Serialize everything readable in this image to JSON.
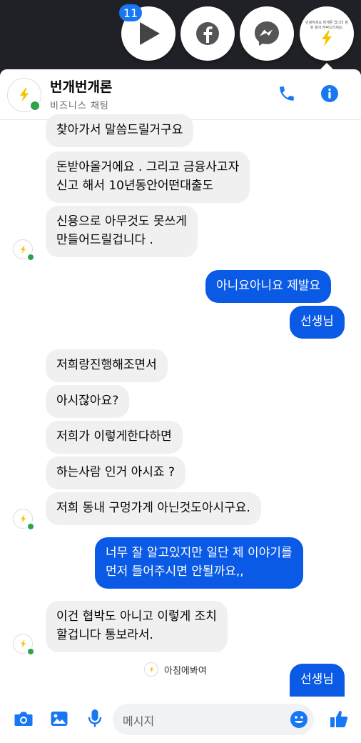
{
  "chat_heads": {
    "badge_count": "11",
    "items": [
      {
        "name": "play-head"
      },
      {
        "name": "facebook-head"
      },
      {
        "name": "messenger-head"
      },
      {
        "name": "business-head"
      }
    ],
    "business_avatar_text": "안녕하세요 번개론 입니다 참된 분의 부탁드리세요."
  },
  "header": {
    "title": "번개번개론",
    "subtitle": "비즈니스 채팅"
  },
  "messages": [
    {
      "dir": "in",
      "lines": [
        "찾아가서 말씀드릴거구요"
      ]
    },
    {
      "dir": "in",
      "lines": [
        "돈받아올거에요 . 그리고 금융사고자",
        "신고 해서 10년동안어떤대출도"
      ]
    },
    {
      "dir": "in",
      "lines": [
        "신용으로 아무것도 못쓰게",
        "만들어드릴겁니다 ."
      ]
    },
    {
      "dir": "out",
      "lines": [
        "아니요아니요 제발요"
      ]
    },
    {
      "dir": "out",
      "lines": [
        "선생님"
      ]
    },
    {
      "dir": "in",
      "lines": [
        "저희랑진행해조면서"
      ]
    },
    {
      "dir": "in",
      "lines": [
        "아시잖아요?"
      ]
    },
    {
      "dir": "in",
      "lines": [
        "저희가 이렇게한다하면"
      ]
    },
    {
      "dir": "in",
      "lines": [
        "하는사람 인거 아시죠 ?"
      ]
    },
    {
      "dir": "in",
      "lines": [
        "저희 동내 구멍가게 아닌것도아시구요."
      ]
    },
    {
      "dir": "out",
      "lines": [
        "너무 잘 알고있지만 일단 제 이야기를",
        "먼저 들어주시면 안될까요,,"
      ]
    },
    {
      "dir": "in",
      "lines": [
        "이건 협박도 아니고 이렇게 조치",
        "할겁니다 통보라서."
      ]
    },
    {
      "dir": "out",
      "lines": [
        "선생님"
      ]
    }
  ],
  "seen": {
    "text": "아침에봐여"
  },
  "composer": {
    "placeholder": "메시지"
  },
  "colors": {
    "accent": "#0a5ae6",
    "header_icon": "#1877f2",
    "online": "#31a24c",
    "bolt": "#f5c400"
  }
}
